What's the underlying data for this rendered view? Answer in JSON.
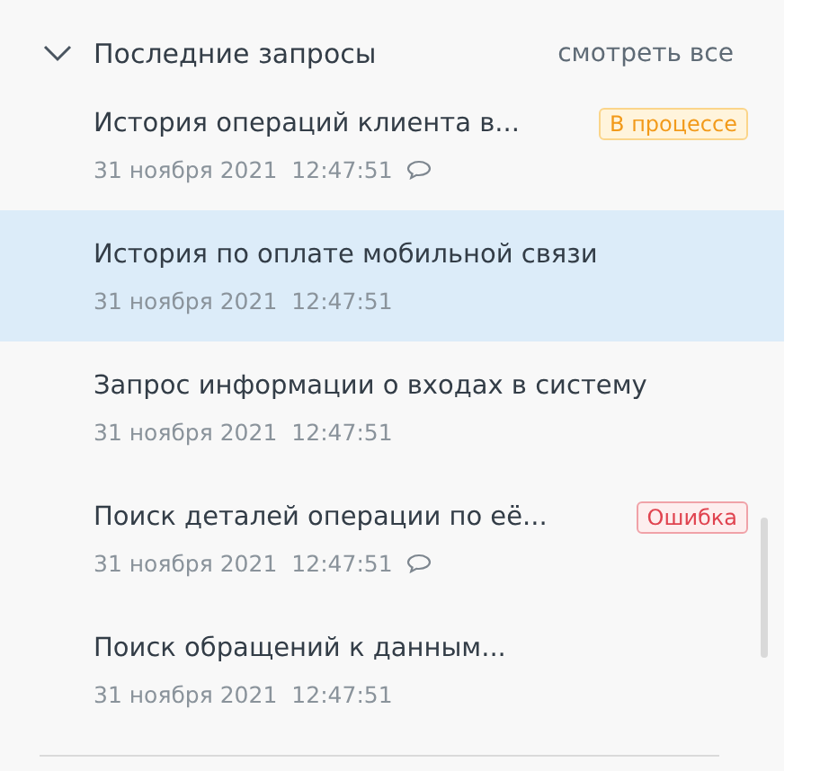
{
  "section": {
    "title": "Последние запросы",
    "expanded": true,
    "link": "смотреть все"
  },
  "requests": [
    {
      "title": "История операций клиента в...",
      "date": "31 ноября 2021",
      "time": "12:47:51",
      "comment": true,
      "selected": false,
      "status": {
        "kind": "progress",
        "label": "В процессе"
      }
    },
    {
      "title": "История по оплате мобильной связи",
      "date": "31 ноября 2021",
      "time": "12:47:51",
      "comment": false,
      "selected": true
    },
    {
      "title": "Запрос информации о входах в систему",
      "date": "31 ноября 2021",
      "time": "12:47:51",
      "comment": false,
      "selected": false
    },
    {
      "title": "Поиск деталей операции по её...",
      "date": "31 ноября 2021",
      "time": "12:47:51",
      "comment": true,
      "selected": false,
      "status": {
        "kind": "error",
        "label": "Ошибка"
      }
    },
    {
      "title": "Поиск обращений к данным...",
      "date": "31 ноября 2021",
      "time": "12:47:51",
      "comment": false,
      "selected": false
    }
  ]
}
